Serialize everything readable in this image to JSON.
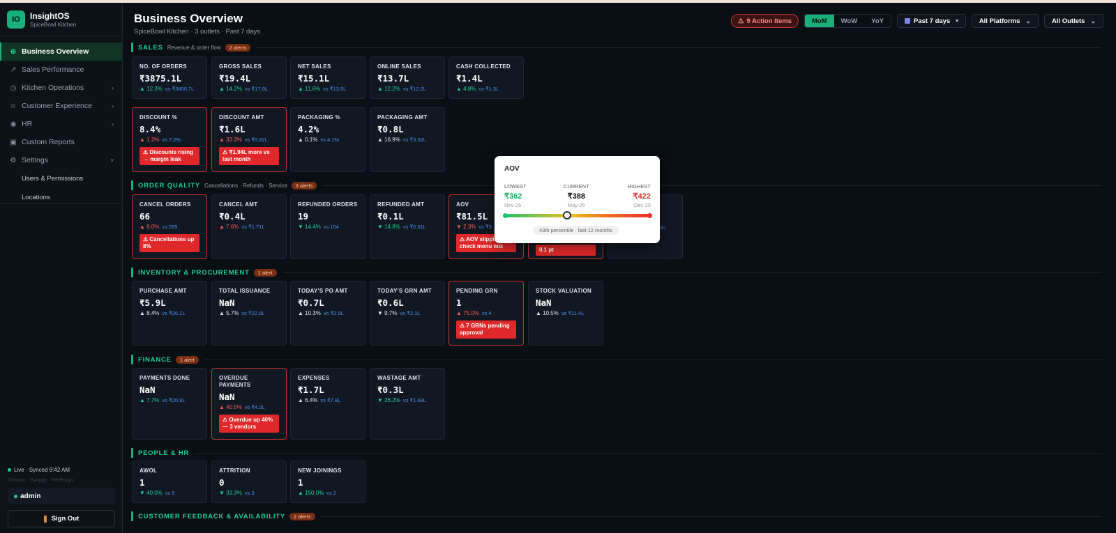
{
  "brand": {
    "logo": "IO",
    "name": "InsightOS",
    "sub": "SpiceBowl Kitchen"
  },
  "nav": {
    "items": [
      {
        "label": "Business Overview",
        "icon": "grid-icon"
      },
      {
        "label": "Sales Performance",
        "icon": "trend-icon"
      },
      {
        "label": "Kitchen Operations",
        "icon": "clock-icon"
      },
      {
        "label": "Customer Experience",
        "icon": "smile-icon"
      },
      {
        "label": "HR",
        "icon": "user-icon"
      },
      {
        "label": "Custom Reports",
        "icon": "report-icon"
      },
      {
        "label": "Settings",
        "icon": "gear-icon"
      }
    ],
    "sub_items": [
      "Users & Permissions",
      "Locations"
    ]
  },
  "footer": {
    "live": "Live · Synced 9:42 AM",
    "platforms": "Zomato · Swiggy · PetPooja",
    "user": "admin",
    "signout": "Sign Out"
  },
  "header": {
    "title": "Business Overview",
    "subtitle": "SpiceBowl Kitchen · 3 outlets · Past 7 days",
    "action_items": "9 Action Items",
    "compare": [
      "MoM",
      "WoW",
      "YoY"
    ],
    "period": "Past 7 days",
    "platforms": "All Platforms",
    "outlets": "All Outlets"
  },
  "sections": {
    "sales": {
      "title": "SALES",
      "sub": "Revenue & order flow",
      "badge": "2 alerts"
    },
    "quality": {
      "title": "ORDER QUALITY",
      "sub": "Cancellations · Refunds · Service",
      "badge": "3 alerts"
    },
    "inventory": {
      "title": "INVENTORY & PROCUREMENT",
      "badge": "1 alert"
    },
    "finance": {
      "title": "FINANCE",
      "badge": "1 alert"
    },
    "people": {
      "title": "PEOPLE & HR"
    },
    "feedback": {
      "title": "CUSTOMER FEEDBACK & AVAILABILITY",
      "badge": "2 alerts"
    }
  },
  "cards": {
    "orders": {
      "label": "NO. OF ORDERS",
      "value": "₹3875.1L",
      "delta": "12.3%",
      "vs": "vs ₹3450.7L"
    },
    "gross": {
      "label": "GROSS SALES",
      "value": "₹19.4L",
      "delta": "14.2%",
      "vs": "vs ₹17.0L"
    },
    "net": {
      "label": "NET SALES",
      "value": "₹15.1L",
      "delta": "11.6%",
      "vs": "vs ₹13.5L"
    },
    "online": {
      "label": "ONLINE SALES",
      "value": "₹13.7L",
      "delta": "12.2%",
      "vs": "vs ₹12.2L"
    },
    "cash": {
      "label": "CASH COLLECTED",
      "value": "₹1.4L",
      "delta": "4.8%",
      "vs": "vs ₹1.3L"
    },
    "discpct": {
      "label": "DISCOUNT %",
      "value": "8.4%",
      "delta": "1.2%",
      "vs": "vs 7.2%",
      "alert": "⚠ Discounts rising → margin leak"
    },
    "discamt": {
      "label": "DISCOUNT AMT",
      "value": "₹1.6L",
      "delta": "33.3%",
      "vs": "vs ₹5.82L",
      "alert": "⚠ ₹1.94L more vs last month"
    },
    "packpct": {
      "label": "PACKAGING %",
      "value": "4.2%",
      "delta": "0.1%",
      "vs": "vs 4.1%"
    },
    "packamt": {
      "label": "PACKAGING AMT",
      "value": "₹0.8L",
      "delta": "16.9%",
      "vs": "vs ₹3.32L"
    },
    "cancel": {
      "label": "CANCEL ORDERS",
      "value": "66",
      "delta": "8.0%",
      "vs": "vs 289",
      "alert": "⚠ Cancellations up 8%"
    },
    "cancelamt": {
      "label": "CANCEL AMT",
      "value": "₹0.4L",
      "delta": "7.6%",
      "vs": "vs ₹1.71L"
    },
    "refunded": {
      "label": "REFUNDED ORDERS",
      "value": "19",
      "delta": "14.4%",
      "vs": "vs 104"
    },
    "refundamt": {
      "label": "REFUNDED AMT",
      "value": "₹0.1L",
      "delta": "14.8%",
      "vs": "vs ₹0.61L"
    },
    "aov": {
      "label": "AOV",
      "value": "₹81.5L",
      "delta": "2.3%",
      "vs": "vs ₹3",
      "alert": "⚠ AOV slipping — check menu mix"
    },
    "hidden1": {
      "alert": "0.1 pt"
    },
    "hidden2": {
      "vs": "min"
    },
    "purchase": {
      "label": "PURCHASE AMT",
      "value": "₹5.9L",
      "delta": "8.4%",
      "vs": "vs ₹26.1L"
    },
    "issuance": {
      "label": "TOTAL ISSUANCE",
      "value": "NaN",
      "delta": "5.7%",
      "vs": "vs ₹22.8L"
    },
    "po": {
      "label": "TODAY'S PO AMT",
      "value": "₹0.7L",
      "delta": "10.3%",
      "vs": "vs ₹2.9L"
    },
    "grn": {
      "label": "TODAY'S GRN AMT",
      "value": "₹0.6L",
      "delta": "9.7%",
      "vs": "vs ₹3.1L"
    },
    "pendgrn": {
      "label": "PENDING GRN",
      "value": "1",
      "delta": "75.0%",
      "vs": "vs 4",
      "alert": "⚠ 7 GRNs pending approval"
    },
    "stock": {
      "label": "STOCK VALUATION",
      "value": "NaN",
      "delta": "10.5%",
      "vs": "vs ₹11.4L"
    },
    "payments": {
      "label": "PAYMENTS DONE",
      "value": "NaN",
      "delta": "7.7%",
      "vs": "vs ₹20.8L"
    },
    "overdue": {
      "label": "OVERDUE PAYMENTS",
      "value": "NaN",
      "delta": "40.5%",
      "vs": "vs ₹4.2L",
      "alert": "⚠ Overdue up 40% — 3 vendors"
    },
    "expenses": {
      "label": "EXPENSES",
      "value": "₹1.7L",
      "delta": "6.4%",
      "vs": "vs ₹7.8L"
    },
    "wastage": {
      "label": "WASTAGE AMT",
      "value": "₹0.3L",
      "delta": "26.2%",
      "vs": "vs ₹1.68L"
    },
    "awol": {
      "label": "AWOL",
      "value": "1",
      "delta": "40.0%",
      "vs": "vs 5"
    },
    "attrition": {
      "label": "ATTRITION",
      "value": "0",
      "delta": "33.3%",
      "vs": "vs 3"
    },
    "joinings": {
      "label": "NEW JOININGS",
      "value": "1",
      "delta": "150.0%",
      "vs": "vs 2"
    }
  },
  "tooltip": {
    "title": "AOV",
    "lowest_label": "LOWEST",
    "lowest_value": "₹362",
    "lowest_month": "Nov-25",
    "current_label": "CURRENT",
    "current_value": "₹388",
    "current_month": "May-26",
    "highest_label": "HIGHEST",
    "highest_value": "₹422",
    "highest_month": "Dec-25",
    "percentile_fraction": 0.43,
    "percentile_text": "43th percentile · last 12 months",
    "colors": {
      "low": "#1fbf6e",
      "high": "#e8302a"
    }
  }
}
